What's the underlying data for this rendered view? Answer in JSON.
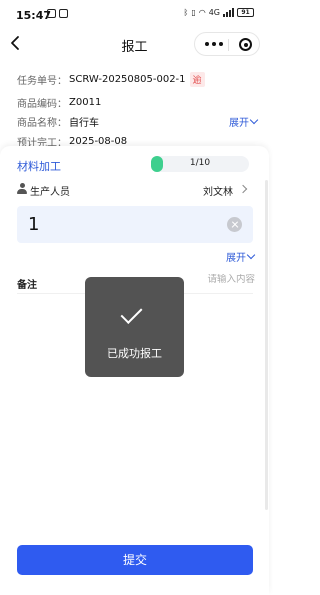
{
  "status_bar": {
    "time": "15:47",
    "battery": "91",
    "network": "4G"
  },
  "nav": {
    "title": "报工"
  },
  "info": {
    "task_no_label": "任务单号：",
    "task_no_value": "SCRW-20250805-002-1",
    "overdue_tag": "逾",
    "product_code_label": "商品编码：",
    "product_code_value": "Z0011",
    "product_name_label": "商品名称：",
    "product_name_value": "自行车",
    "expected_label": "预计完工：",
    "expected_value": "2025-08-08",
    "expand_label": "展开"
  },
  "process": {
    "name": "材料加工",
    "progress_text": "1/10",
    "progress_fraction": 0.1
  },
  "producer": {
    "label": "生产人员",
    "value": "刘文林"
  },
  "quantity": {
    "value": "1"
  },
  "expand_more": {
    "label": "展开"
  },
  "remark": {
    "label": "备注",
    "placeholder": "请输入内容"
  },
  "toast": {
    "message": "已成功报工"
  },
  "submit": {
    "label": "提交"
  },
  "colors": {
    "accent": "#2f5bf0",
    "link": "#2f5bd8",
    "progress": "#3ecf8e",
    "overdue": "#e24a4a"
  }
}
